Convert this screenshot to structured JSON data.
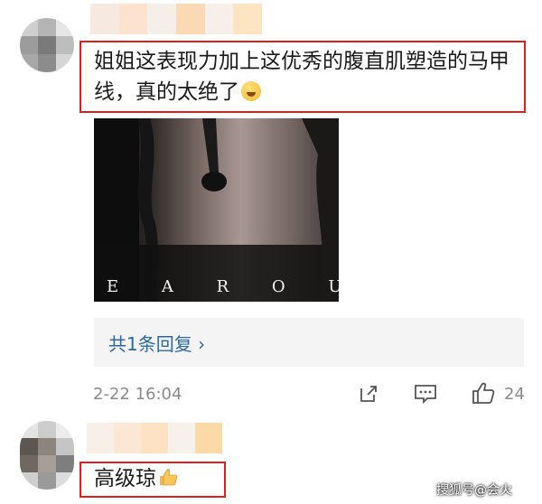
{
  "comment1": {
    "text": "姐姐这表现力加上这优秀的腹直肌塑造的马甲线，真的太绝了",
    "emoji": "smiling-face-emoji"
  },
  "photo": {
    "caption": "E A R O U G H I"
  },
  "replies": {
    "label": "共1条回复 ›"
  },
  "meta": {
    "timestamp": "2-22 16:04",
    "like_count": "24"
  },
  "comment2": {
    "text": "高级琼",
    "emoji": "thumbs-up-emoji"
  },
  "watermark": "搜狐号@会火",
  "colors": {
    "highlight_border": "#e01e1e",
    "link": "#2c69a3",
    "meta_gray": "#8a8a8a"
  }
}
